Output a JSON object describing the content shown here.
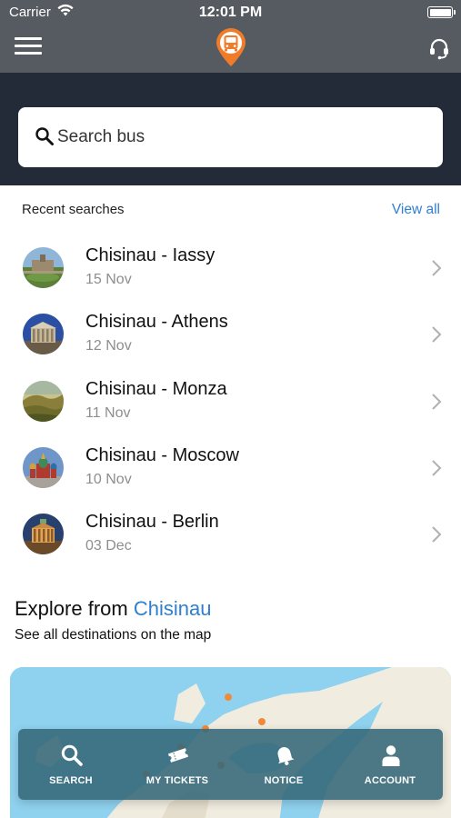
{
  "status_bar": {
    "carrier": "Carrier",
    "time": "12:01 PM"
  },
  "header": {
    "menu_icon": "hamburger-icon",
    "logo_icon": "bus-pin-logo-icon",
    "support_icon": "headset-icon",
    "colors": {
      "header": "#565b61",
      "band": "#232a38",
      "logo": "#f07c2a"
    }
  },
  "search": {
    "placeholder": "Search bus",
    "icon": "search-icon"
  },
  "recent": {
    "title": "Recent searches",
    "view_all": "View all",
    "items": [
      {
        "route": "Chisinau - Iassy",
        "date": "15 Nov"
      },
      {
        "route": "Chisinau - Athens",
        "date": "12 Nov"
      },
      {
        "route": "Chisinau - Monza",
        "date": "11 Nov"
      },
      {
        "route": "Chisinau - Moscow",
        "date": "10 Nov"
      },
      {
        "route": "Chisinau - Berlin",
        "date": "03 Dec"
      }
    ]
  },
  "explore": {
    "title_prefix": "Explore from ",
    "city": "Chisinau",
    "subtitle": "See all destinations on the map"
  },
  "tabs": [
    {
      "label": "SEARCH",
      "icon": "search-icon"
    },
    {
      "label": "MY TICKETS",
      "icon": "ticket-icon"
    },
    {
      "label": "NOTICE",
      "icon": "bell-icon"
    },
    {
      "label": "ACCOUNT",
      "icon": "user-icon"
    }
  ],
  "accent_color": "#2f7fd0"
}
